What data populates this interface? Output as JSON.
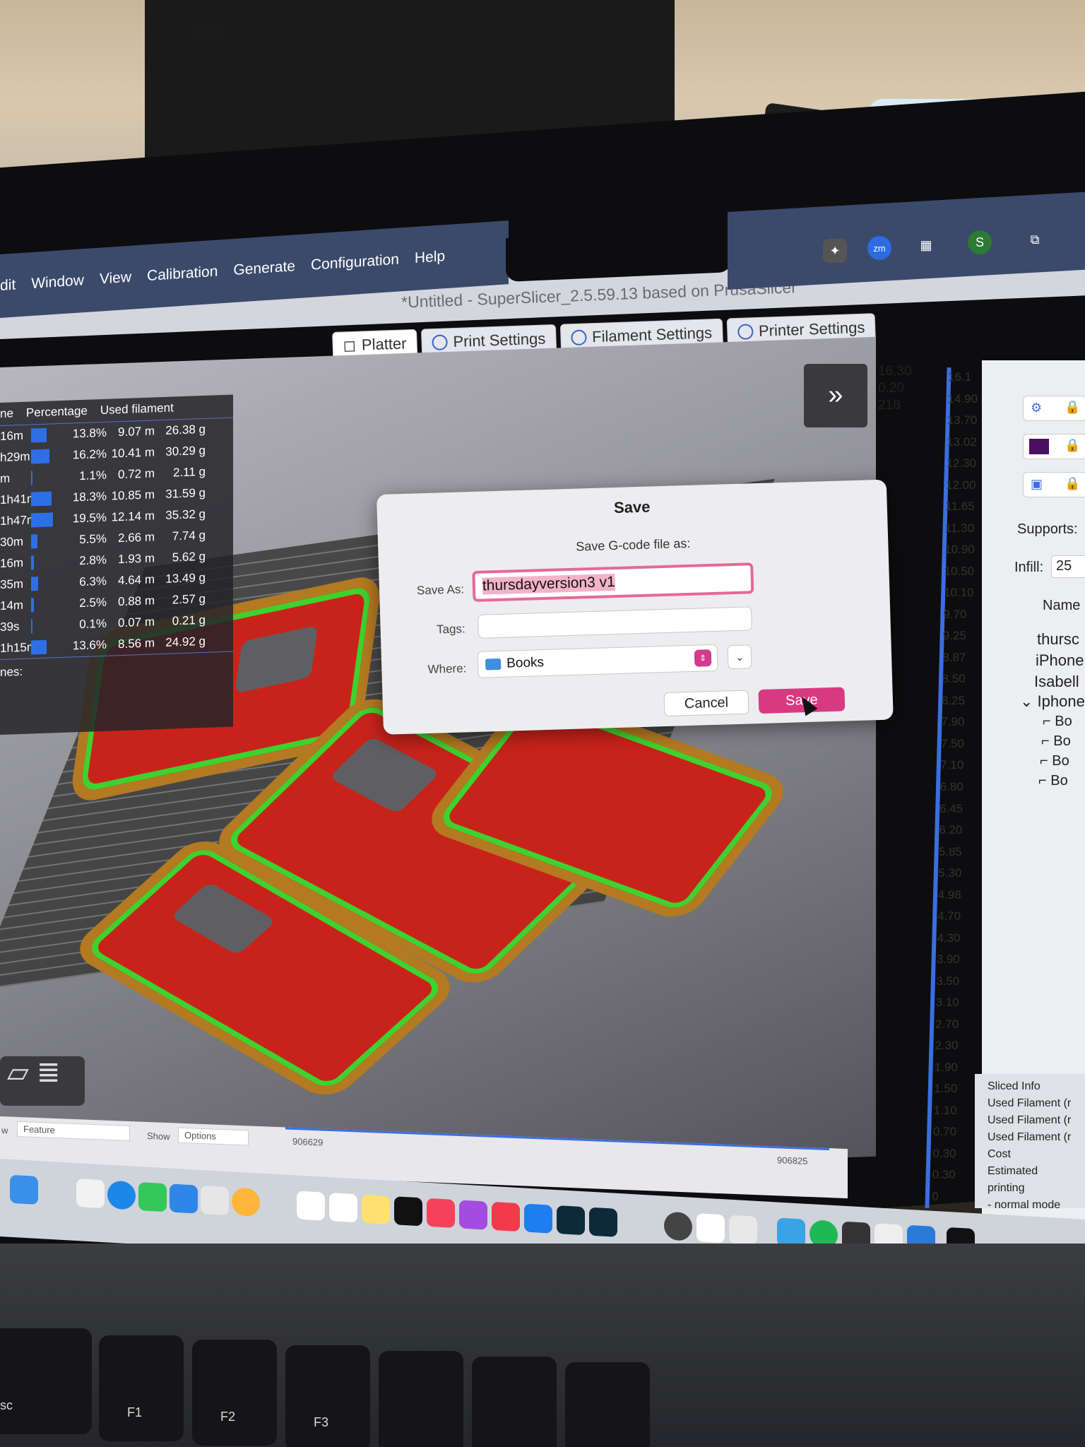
{
  "menubar": {
    "items": [
      "dit",
      "Window",
      "View",
      "Calibration",
      "Generate",
      "Configuration",
      "Help"
    ]
  },
  "window": {
    "title": "*Untitled - SuperSlicer_2.5.59.13  based on PrusaSlicer"
  },
  "tabs": [
    {
      "label": "Platter",
      "icon": "cube-icon",
      "active": true
    },
    {
      "label": "Print Settings",
      "icon": "gear-icon",
      "active": false
    },
    {
      "label": "Filament Settings",
      "icon": "spool-icon",
      "active": false
    },
    {
      "label": "Printer Settings",
      "icon": "printer-icon",
      "active": false
    }
  ],
  "stats": {
    "headers": [
      "ne",
      "Percentage",
      "Used filament"
    ],
    "rows": [
      {
        "time": "16m",
        "pct": "13.8%",
        "len": "9.07 m",
        "wt": "26.38 g",
        "frac": 0.138
      },
      {
        "time": "h29m",
        "pct": "16.2%",
        "len": "10.41 m",
        "wt": "30.29 g",
        "frac": 0.162
      },
      {
        "time": "m",
        "pct": "1.1%",
        "len": "0.72 m",
        "wt": "2.11 g",
        "frac": 0.011
      },
      {
        "time": "1h41m",
        "pct": "18.3%",
        "len": "10.85 m",
        "wt": "31.59 g",
        "frac": 0.183
      },
      {
        "time": "1h47m",
        "pct": "19.5%",
        "len": "12.14 m",
        "wt": "35.32 g",
        "frac": 0.195
      },
      {
        "time": "30m",
        "pct": "5.5%",
        "len": "2.66 m",
        "wt": "7.74 g",
        "frac": 0.055
      },
      {
        "time": "16m",
        "pct": "2.8%",
        "len": "1.93 m",
        "wt": "5.62 g",
        "frac": 0.028
      },
      {
        "time": "35m",
        "pct": "6.3%",
        "len": "4.64 m",
        "wt": "13.49 g",
        "frac": 0.063
      },
      {
        "time": "14m",
        "pct": "2.5%",
        "len": "0.88 m",
        "wt": "2.57 g",
        "frac": 0.025
      },
      {
        "time": "39s",
        "pct": "0.1%",
        "len": "0.07 m",
        "wt": "0.21 g",
        "frac": 0.001
      },
      {
        "time": "1h15m",
        "pct": "13.6%",
        "len": "8.56 m",
        "wt": "24.92 g",
        "frac": 0.136
      }
    ],
    "footer": "nes:"
  },
  "layer_info": {
    "height": "16.30",
    "layer_height": "0.20",
    "layer": "218"
  },
  "scale_ticks": [
    "16.1",
    "14.90",
    "13.70",
    "13.02",
    "12.30",
    "12.00",
    "11.65",
    "11.30",
    "10.90",
    "10.50",
    "10.10",
    "9.70",
    "9.25",
    "8.87",
    "8.50",
    "8.25",
    "7.90",
    "7.50",
    "7.10",
    "6.80",
    "6.45",
    "6.20",
    "5.85",
    "5.30",
    "4.98",
    "4.70",
    "4.30",
    "3.90",
    "3.50",
    "3.10",
    "2.70",
    "2.30",
    "1.90",
    "1.50",
    "1.10",
    "0.70",
    "0.30",
    "0.30",
    "0"
  ],
  "right_panel": {
    "supports_label": "Supports:",
    "infill_label": "Infill:",
    "infill_value": "25",
    "name_header": "Name",
    "objects": [
      "thursc",
      "iPhone",
      "Isabell",
      "Iphone"
    ],
    "sub_items": [
      "Bo",
      "Bo",
      "Bo",
      "Bo"
    ],
    "sliced_info": "Sliced Info",
    "info_rows": [
      "Used Filament (r",
      "Used Filament (r",
      "Used Filament (r",
      "Cost",
      "Estimated printing",
      "- normal mode"
    ]
  },
  "dialog": {
    "title": "Save",
    "subtitle": "Save G-code file as:",
    "save_as_label": "Save As:",
    "save_as_value": "thursdayversion3 v1",
    "tags_label": "Tags:",
    "tags_value": "",
    "where_label": "Where:",
    "where_value": "Books",
    "cancel_label": "Cancel",
    "save_label": "Save"
  },
  "bottom": {
    "view_label": "w",
    "view_value": "Feature",
    "show_label": "Show",
    "show_value": "Options",
    "range_left": "906629",
    "range_right": "906825"
  },
  "keys": [
    "sc",
    "F1",
    "F2",
    "F3"
  ],
  "colors": {
    "accent": "#3b6ee0",
    "save_button": "#d83a82",
    "menubar": "#3b4a6b",
    "part_red": "#c8231b",
    "part_green": "#3ed22f",
    "part_orange": "#b37a21"
  }
}
